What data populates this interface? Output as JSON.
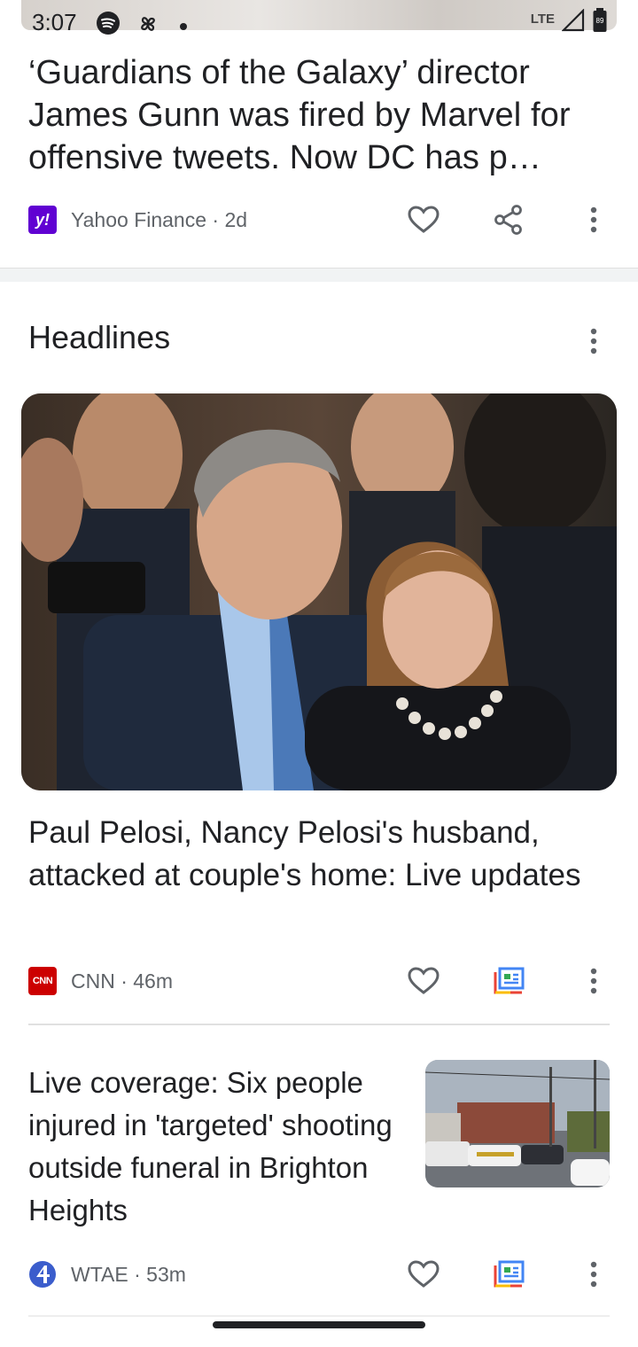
{
  "status_bar": {
    "time": "3:07",
    "network": "LTE",
    "battery": "89",
    "icons": [
      "spotify-icon",
      "pinwheel-icon",
      "dot-icon",
      "signal-icon",
      "battery-icon"
    ]
  },
  "card1": {
    "title": "‘Guardians of the Galaxy’ director James Gunn was fired by Marvel for offensive tweets. Now DC has p…",
    "source": "Yahoo Finance · 2d",
    "logo_text": "y!"
  },
  "headlines": {
    "section_title": "Headlines",
    "stories": [
      {
        "title": "Paul Pelosi, Nancy Pelosi's husband, attacked at couple's home: Live updates",
        "source": "CNN · 46m",
        "logo_text": "CNN"
      },
      {
        "title": "Live coverage: Six people injured in 'targeted' shooting outside funeral in Brighton Heights",
        "source": "WTAE · 53m"
      }
    ]
  },
  "colors": {
    "yahoo": "#6001d2",
    "cnn": "#cc0000",
    "wtae": "#3b5dcc",
    "text_secondary": "#5f6368"
  }
}
